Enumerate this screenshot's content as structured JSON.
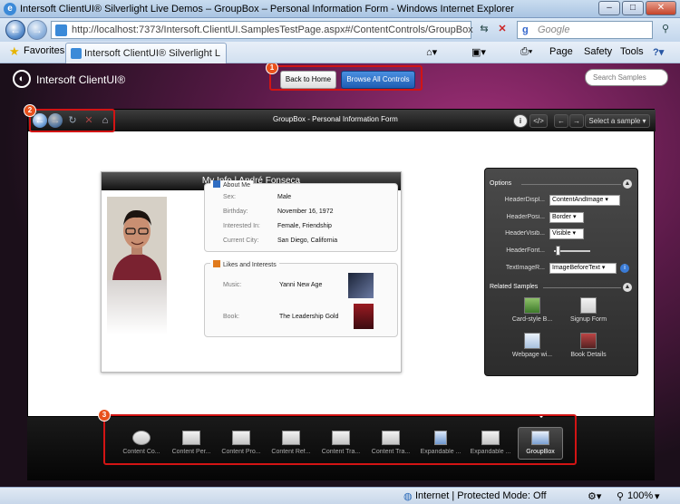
{
  "window": {
    "title": "Intersoft ClientUI® Silverlight Live Demos – GroupBox – Personal Information Form - Windows Internet Explorer"
  },
  "address_bar": {
    "url": "http://localhost:7373/Intersoft.ClientUI.SamplesTestPage.aspx#/ContentControls/GroupBox"
  },
  "search": {
    "placeholder": "Google"
  },
  "favorites": {
    "label": "Favorites",
    "tab_title": "Intersoft ClientUI® Silverlight Live De..."
  },
  "command_bar": {
    "page": "Page",
    "safety": "Safety",
    "tools": "Tools"
  },
  "app": {
    "brand": "Intersoft ClientUI®",
    "back_home": "Back to Home",
    "browse_all": "Browse All Controls",
    "search_placeholder": "Search Samples",
    "frame_title": "GroupBox - Personal Information Form",
    "select_sample": "Select a sample",
    "badges": [
      "1",
      "2",
      "3"
    ]
  },
  "card": {
    "header": "My Info | André Fonseca",
    "about": {
      "title": "About Me",
      "rows": [
        {
          "label": "Sex:",
          "value": "Male"
        },
        {
          "label": "Birthday:",
          "value": "November 16, 1972"
        },
        {
          "label": "Interested In:",
          "value": "Female, Friendship"
        },
        {
          "label": "Current City:",
          "value": "San Diego, California"
        }
      ]
    },
    "likes": {
      "title": "Likes and Interests",
      "rows": [
        {
          "label": "Music:",
          "value": "Yanni New Age"
        },
        {
          "label": "Book:",
          "value": "The Leadership Gold"
        }
      ]
    }
  },
  "options": {
    "title": "Options",
    "rows": [
      {
        "label": "HeaderDispl...",
        "value": "ContentAndImage"
      },
      {
        "label": "HeaderPosi...",
        "value": "Border"
      },
      {
        "label": "HeaderVisib...",
        "value": "Visible"
      },
      {
        "label": "HeaderFont...",
        "value": ""
      },
      {
        "label": "TextImageR...",
        "value": "ImageBeforeText"
      }
    ],
    "related_title": "Related Samples",
    "related": [
      "Card-style B...",
      "Signup Form",
      "Webpage wi...",
      "Book Details"
    ]
  },
  "tray": {
    "items": [
      "Content Co...",
      "Content Per...",
      "Content Pro...",
      "Content Ref...",
      "Content Tra...",
      "Content Tra...",
      "Expandable ...",
      "Expandable ...",
      "GroupBox"
    ]
  },
  "status_bar": {
    "zone": "Internet | Protected Mode: Off",
    "zoom": "100%"
  }
}
